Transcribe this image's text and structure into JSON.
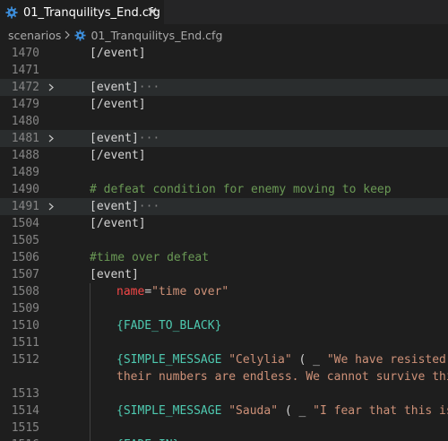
{
  "tab": {
    "title": "01_Tranquilitys_End.cfg",
    "icon": "gear-icon",
    "close_icon": "close-icon"
  },
  "breadcrumb": {
    "folder": "scenarios",
    "file": "01_Tranquilitys_End.cfg"
  },
  "colors": {
    "background": "#1e1e1e",
    "tab_bar": "#252526",
    "line_number": "#858585",
    "comment": "#6a9955",
    "macro": "#4ec9b0",
    "attribute": "#f44747",
    "string": "#ce9178",
    "highlight": "#2a2d2e"
  },
  "lines": [
    {
      "num": "1470",
      "indent": 0,
      "tokens": [
        [
          "[/event]",
          "plain"
        ]
      ]
    },
    {
      "num": "1471",
      "indent": 0,
      "tokens": []
    },
    {
      "num": "1472",
      "indent": 0,
      "fold": true,
      "highlight": true,
      "tokens": [
        [
          "[event]",
          "plain"
        ],
        [
          "···",
          "dim"
        ]
      ]
    },
    {
      "num": "1479",
      "indent": 0,
      "tokens": [
        [
          "[/event]",
          "plain"
        ]
      ]
    },
    {
      "num": "1480",
      "indent": 0,
      "tokens": []
    },
    {
      "num": "1481",
      "indent": 0,
      "fold": true,
      "highlight": true,
      "tokens": [
        [
          "[event]",
          "plain"
        ],
        [
          "···",
          "dim"
        ]
      ]
    },
    {
      "num": "1488",
      "indent": 0,
      "tokens": [
        [
          "[/event]",
          "plain"
        ]
      ]
    },
    {
      "num": "1489",
      "indent": 0,
      "tokens": []
    },
    {
      "num": "1490",
      "indent": 0,
      "tokens": [
        [
          "# defeat condition for enemy moving to keep",
          "comment"
        ]
      ]
    },
    {
      "num": "1491",
      "indent": 0,
      "fold": true,
      "highlight": true,
      "tokens": [
        [
          "[event]",
          "plain"
        ],
        [
          "···",
          "dim"
        ]
      ]
    },
    {
      "num": "1504",
      "indent": 0,
      "tokens": [
        [
          "[/event]",
          "plain"
        ]
      ]
    },
    {
      "num": "1505",
      "indent": 0,
      "tokens": []
    },
    {
      "num": "1506",
      "indent": 0,
      "tokens": [
        [
          "#time over defeat",
          "comment"
        ]
      ]
    },
    {
      "num": "1507",
      "indent": 0,
      "tokens": [
        [
          "[event]",
          "plain"
        ]
      ]
    },
    {
      "num": "1508",
      "indent": 1,
      "tokens": [
        [
          "name",
          "attr"
        ],
        [
          "=",
          "plain"
        ],
        [
          "\"time over\"",
          "str"
        ]
      ]
    },
    {
      "num": "1509",
      "indent": 1,
      "tokens": []
    },
    {
      "num": "1510",
      "indent": 1,
      "tokens": [
        [
          "{FADE_TO_BLACK}",
          "macro"
        ]
      ]
    },
    {
      "num": "1511",
      "indent": 1,
      "tokens": []
    },
    {
      "num": "1512",
      "indent": 1,
      "tokens": [
        [
          "{SIMPLE_MESSAGE ",
          "macro"
        ],
        [
          "\"Celylia\"",
          "str"
        ],
        [
          " ( _ ",
          "plain"
        ],
        [
          "\"We have resisted their attacks for as long as possible, but",
          "str"
        ]
      ]
    },
    {
      "num": "",
      "indent": 1,
      "tokens": [
        [
          "their numbers are endless. We cannot survive this onslaught much longer.\")}",
          "str"
        ]
      ]
    },
    {
      "num": "1513",
      "indent": 1,
      "tokens": []
    },
    {
      "num": "1514",
      "indent": 1,
      "tokens": [
        [
          "{SIMPLE_MESSAGE ",
          "macro"
        ],
        [
          "\"Sauda\"",
          "str"
        ],
        [
          " ( _ ",
          "plain"
        ],
        [
          "\"I fear that this is the end.\")}",
          "str"
        ]
      ]
    },
    {
      "num": "1515",
      "indent": 1,
      "tokens": []
    },
    {
      "num": "1516",
      "indent": 1,
      "tokens": [
        [
          "{FADE_IN}",
          "macro"
        ]
      ]
    }
  ]
}
